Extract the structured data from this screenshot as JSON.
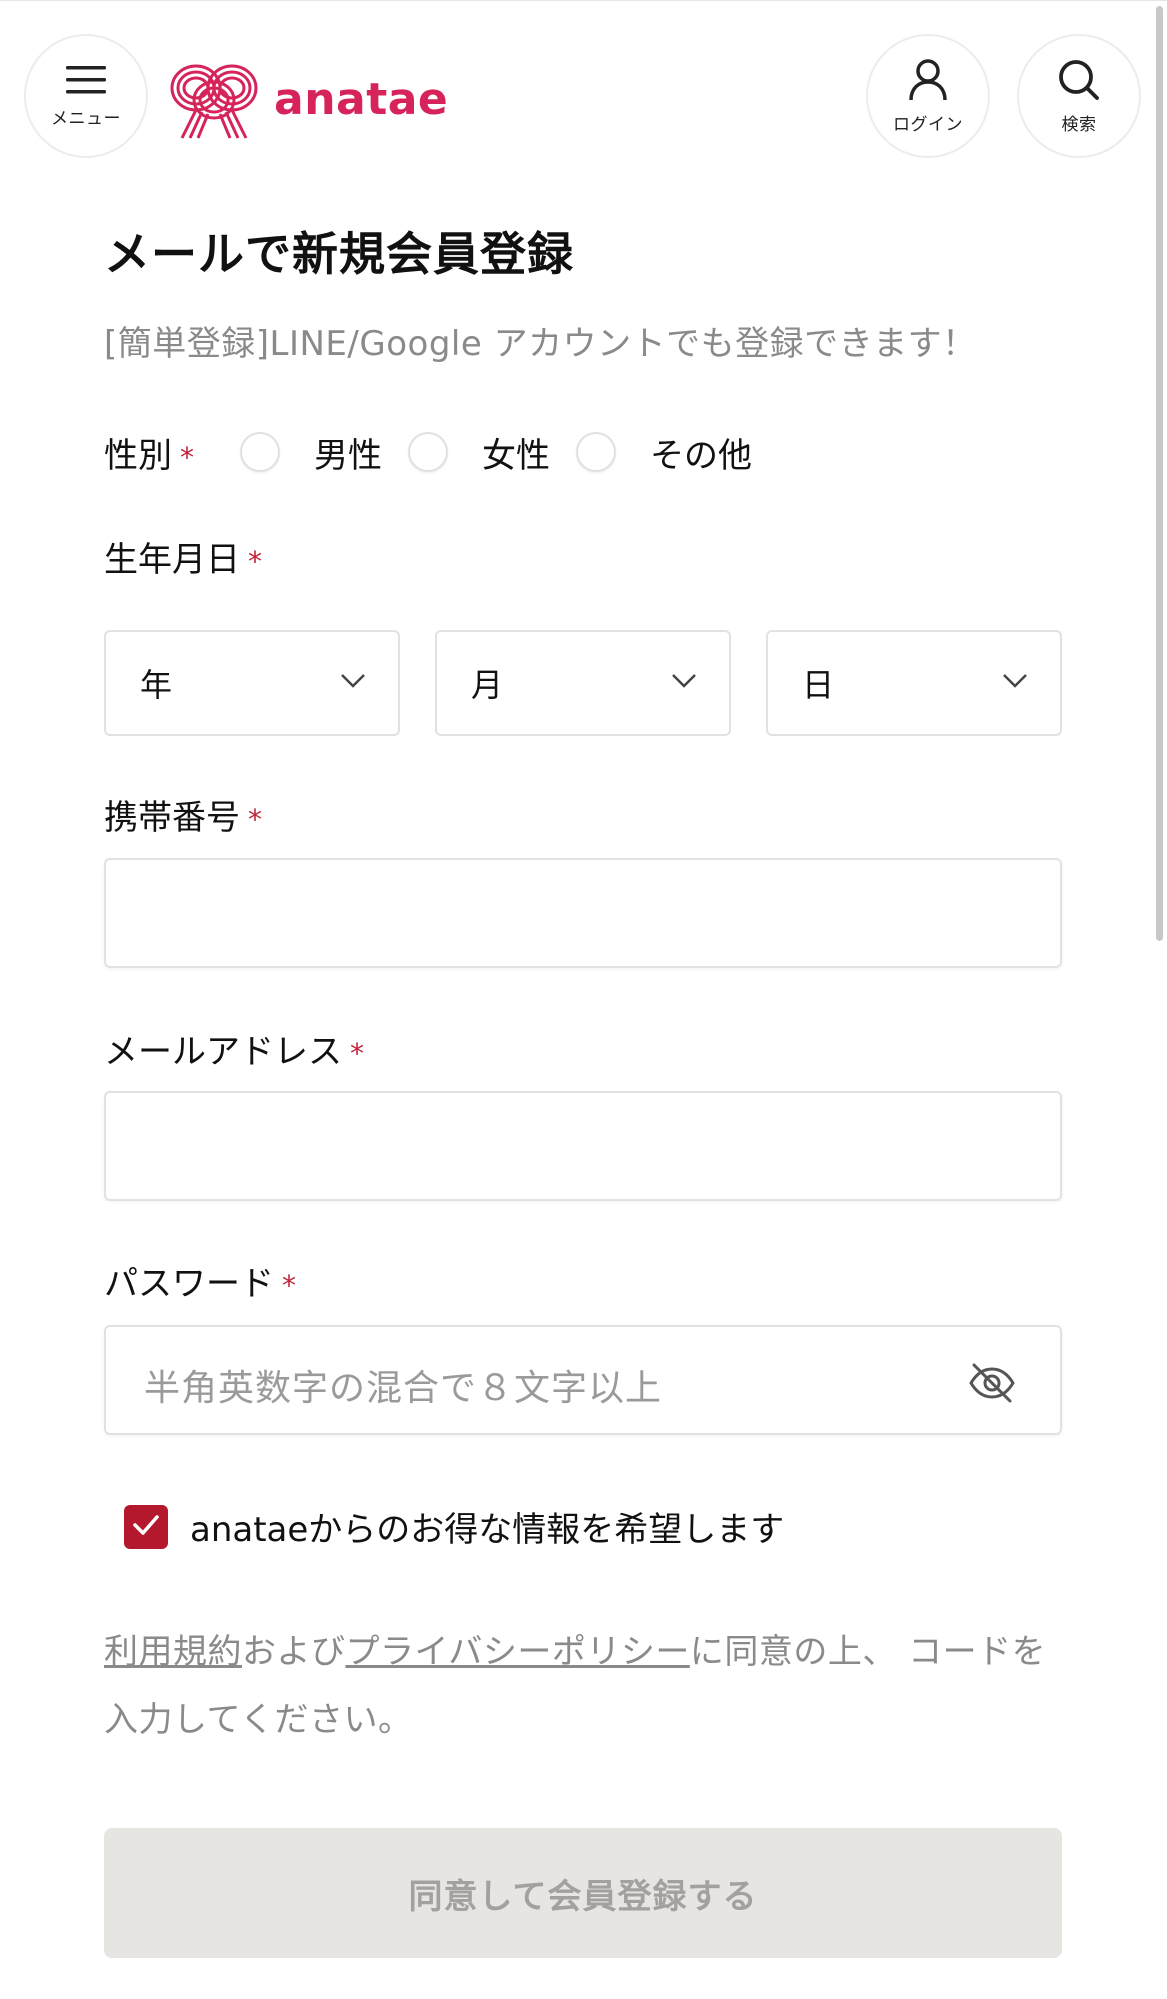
{
  "header": {
    "menu_label": "メニュー",
    "brand": "anatae",
    "login_label": "ログイン",
    "search_label": "検索"
  },
  "form": {
    "title": "メールで新規会員登録",
    "subtitle": "[簡単登録]LINE/Google アカウントでも登録できます！",
    "required_mark": "*",
    "gender": {
      "label": "性別",
      "options": [
        "男性",
        "女性",
        "その他"
      ]
    },
    "birthdate": {
      "label": "生年月日",
      "year": "年",
      "month": "月",
      "day": "日"
    },
    "phone": {
      "label": "携帯番号",
      "value": ""
    },
    "email": {
      "label": "メールアドレス",
      "value": ""
    },
    "password": {
      "label": "パスワード",
      "placeholder": "半角英数字の混合で８文字以上"
    },
    "newsletter": {
      "label": "anataeからのお得な情報を希望します",
      "checked": true
    },
    "terms": {
      "link_terms": "利用規約",
      "and": "および",
      "link_privacy": "プライバシーポリシー",
      "rest": "に同意の上、 コードを入力してください。"
    },
    "submit_label": "同意して会員登録する"
  },
  "colors": {
    "brand": "#d6245a",
    "required": "#c0243a",
    "checkbox": "#b3182c",
    "submit_disabled_bg": "#e6e5e2"
  }
}
